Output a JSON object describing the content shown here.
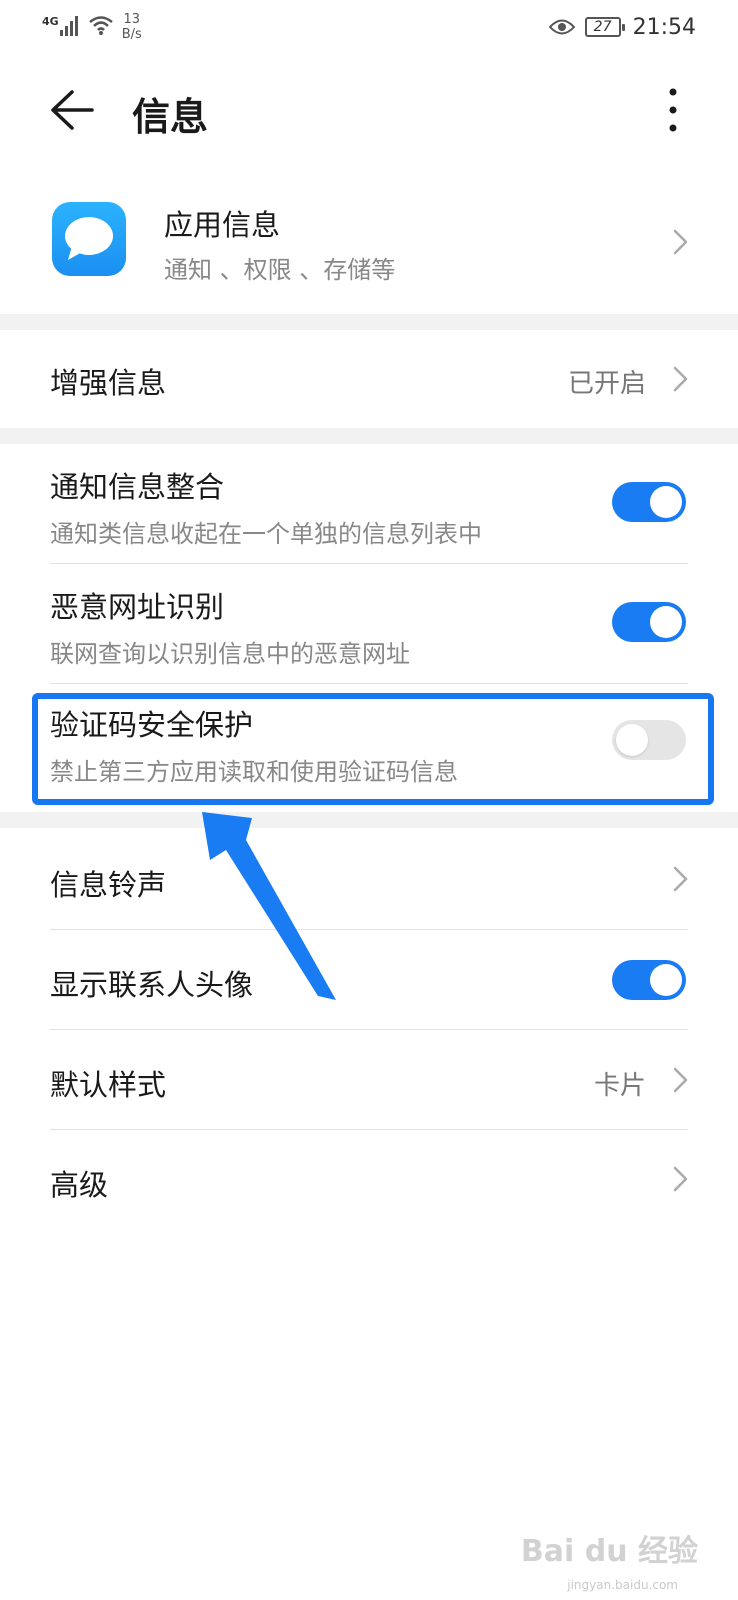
{
  "status_bar": {
    "network": "4G",
    "speed_value": "13",
    "speed_unit": "B/s",
    "battery": "27",
    "time": "21:54"
  },
  "header": {
    "title": "信息"
  },
  "app_info": {
    "title": "应用信息",
    "subtitle": "通知 、权限 、存储等"
  },
  "enhanced": {
    "label": "增强信息",
    "value": "已开启"
  },
  "notify_merge": {
    "label": "通知信息整合",
    "subtitle": "通知类信息收起在一个单独的信息列表中",
    "enabled": true
  },
  "malicious_url": {
    "label": "恶意网址识别",
    "subtitle": "联网查询以识别信息中的恶意网址",
    "enabled": true
  },
  "code_protect": {
    "label": "验证码安全保护",
    "subtitle": "禁止第三方应用读取和使用验证码信息",
    "enabled": false
  },
  "ringtone": {
    "label": "信息铃声"
  },
  "contact_avatar": {
    "label": "显示联系人头像",
    "enabled": true
  },
  "default_style": {
    "label": "默认样式",
    "value": "卡片"
  },
  "advanced": {
    "label": "高级"
  },
  "watermark": {
    "text": "Bai du 经验",
    "sub": "jingyan.baidu.com"
  },
  "colors": {
    "accent": "#1a7cf2",
    "highlight": "#1677f0",
    "section_gap": "#f2f2f2"
  }
}
